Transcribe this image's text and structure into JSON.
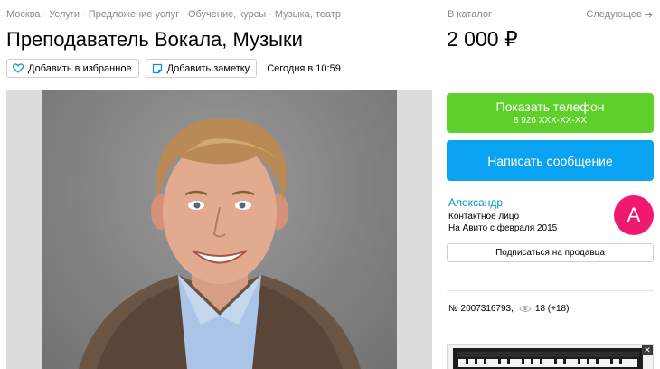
{
  "breadcrumbs": [
    {
      "label": "Москва"
    },
    {
      "label": "Услуги"
    },
    {
      "label": "Предложение услуг"
    },
    {
      "label": "Обучение, курсы"
    },
    {
      "label": "Музыка, театр"
    }
  ],
  "breadcrumb_separator": "·",
  "title": "Преподаватель Вокала, Музыки",
  "actions": {
    "favorite_label": "Добавить в избранное",
    "note_label": "Добавить заметку",
    "date": "Сегодня в 10:59"
  },
  "catalog": {
    "label": "В каталог",
    "next_label": "Следующее"
  },
  "price": "2 000 ₽",
  "contact": {
    "show_phone_label": "Показать телефон",
    "phone_masked": "8 926 XXX-XX-XX",
    "message_label": "Написать сообщение"
  },
  "seller": {
    "name": "Александр",
    "role": "Контактное лицо",
    "since": "На Авито с февраля 2015",
    "avatar_letter": "А",
    "subscribe_label": "Подписаться на продавца"
  },
  "listing": {
    "number": "№ 2007316793,",
    "views": "18 (+18)"
  },
  "ad": {
    "close_label": "✕"
  },
  "colors": {
    "green": "#5fcf2b",
    "blue": "#0aa3f2",
    "link": "#0a8fd8",
    "avatar": "#f0186f",
    "muted": "#8a8a8a"
  },
  "icons": [
    "heart-icon",
    "note-icon",
    "arrow-right-icon",
    "eye-icon",
    "close-icon"
  ]
}
